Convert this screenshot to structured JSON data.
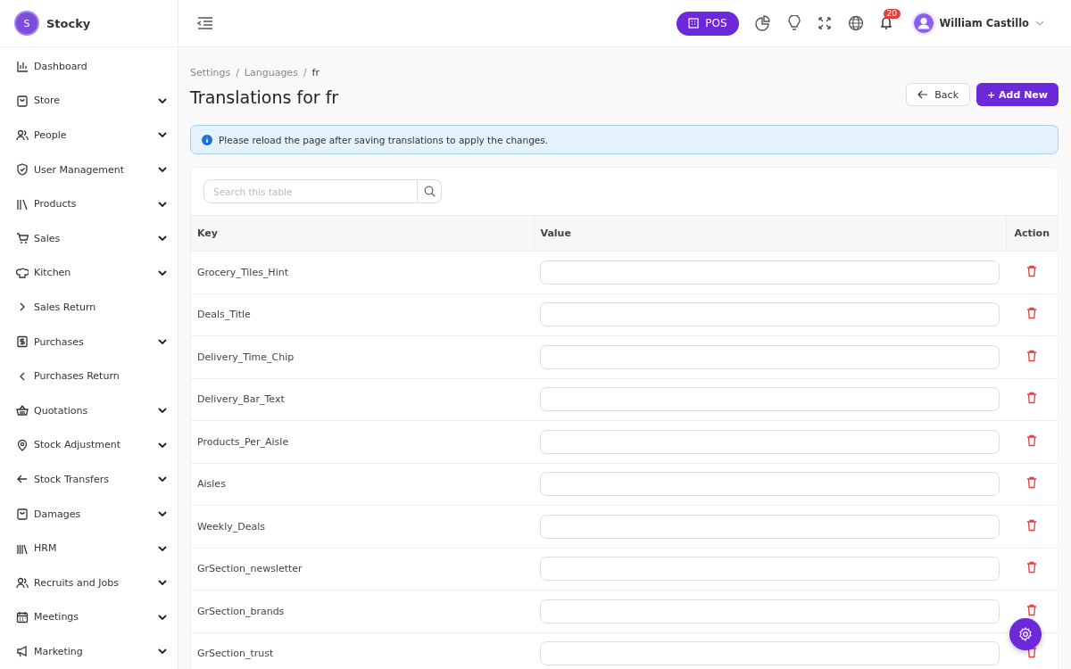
{
  "sidebar": {
    "brand": "Stocky",
    "brand_initial": "S",
    "items": [
      {
        "label": "Dashboard",
        "expandable": false
      },
      {
        "label": "Store",
        "expandable": true
      },
      {
        "label": "People",
        "expandable": true
      },
      {
        "label": "User Management",
        "expandable": true
      },
      {
        "label": "Products",
        "expandable": true
      },
      {
        "label": "Sales",
        "expandable": true
      },
      {
        "label": "Kitchen",
        "expandable": true
      },
      {
        "label": "Sales Return",
        "expandable": false
      },
      {
        "label": "Purchases",
        "expandable": true
      },
      {
        "label": "Purchases Return",
        "expandable": false
      },
      {
        "label": "Quotations",
        "expandable": true
      },
      {
        "label": "Stock Adjustment",
        "expandable": true
      },
      {
        "label": "Stock Transfers",
        "expandable": true
      },
      {
        "label": "Damages",
        "expandable": true
      },
      {
        "label": "HRM",
        "expandable": true
      },
      {
        "label": "Recruits and Jobs",
        "expandable": true
      },
      {
        "label": "Meetings",
        "expandable": true
      },
      {
        "label": "Marketing",
        "expandable": true
      }
    ]
  },
  "topbar": {
    "pos_button": "POS",
    "notification_count": "20",
    "user_name": "William Castillo"
  },
  "breadcrumb": [
    "Settings",
    "Languages",
    "fr"
  ],
  "breadcrumb_separator": "/",
  "title": "Translations for fr",
  "buttons": {
    "back": "Back",
    "add_new": "+ Add New"
  },
  "alert": "Please reload the page after saving translations to apply the changes.",
  "table": {
    "search": {
      "placeholder": "Search this table"
    },
    "columns": [
      "Key",
      "Value",
      "Action"
    ],
    "rows": [
      {
        "key": "Grocery_Tiles_Hint"
      },
      {
        "key": "Deals_Title"
      },
      {
        "key": "Delivery_Time_Chip"
      },
      {
        "key": "Delivery_Bar_Text"
      },
      {
        "key": "Products_Per_Aisle"
      },
      {
        "key": "Aisles"
      },
      {
        "key": "Weekly_Deals"
      },
      {
        "key": "GrSection_newsletter"
      },
      {
        "key": "GrSection_brands"
      },
      {
        "key": "GrSection_trust"
      }
    ]
  }
}
